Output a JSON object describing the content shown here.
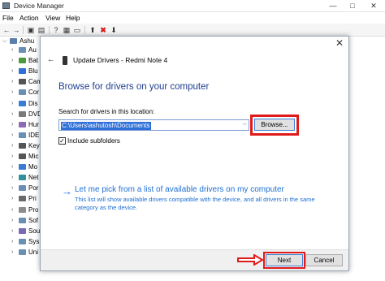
{
  "window": {
    "title": "Device Manager",
    "minimize": "—",
    "maximize": "□",
    "close": "✕"
  },
  "menu": [
    "File",
    "Action",
    "View",
    "Help"
  ],
  "tree": {
    "root": "Ashu",
    "items": [
      "Au",
      "Bat",
      "Blu",
      "Cam",
      "Cor",
      "Dis",
      "DVD",
      "Hur",
      "IDE",
      "Key",
      "Mic",
      "Mo",
      "Net",
      "Por",
      "Pri",
      "Pro",
      "Sof",
      "Sou",
      "Sys",
      "Uni"
    ],
    "icon_colors": [
      "#6a8fb5",
      "#4c9a3c",
      "#2f6fd8",
      "#555555",
      "#6a8fb5",
      "#3a7bd5",
      "#7a7a7a",
      "#8c6ab5",
      "#6a8fb5",
      "#555555",
      "#555555",
      "#3a7bd5",
      "#2f8f9a",
      "#6a8fb5",
      "#6a6a6a",
      "#8c8c8c",
      "#6a8fb5",
      "#7a6ab5",
      "#6a8fb5",
      "#6a8fb5"
    ]
  },
  "dialog": {
    "close": "✕",
    "back": "←",
    "title": "Update Drivers - Redmi Note 4",
    "heading": "Browse for drivers on your computer",
    "search_label": "Search for drivers in this location:",
    "path_value": "C:\\Users\\ashutosh\\Documents",
    "browse_label": "Browse...",
    "include_subfolders": "Include subfolders",
    "include_checked": "✓",
    "pick_arrow": "→",
    "pick_link": "Let me pick from a list of available drivers on my computer",
    "pick_desc": "This list will show available drivers compatible with the device, and all drivers in the same category as the device.",
    "next_label": "Next",
    "cancel_label": "Cancel"
  },
  "colors": {
    "accent": "#1e6fd2",
    "highlight_red": "#e01b1b",
    "heading_blue": "#1e3d8f"
  }
}
